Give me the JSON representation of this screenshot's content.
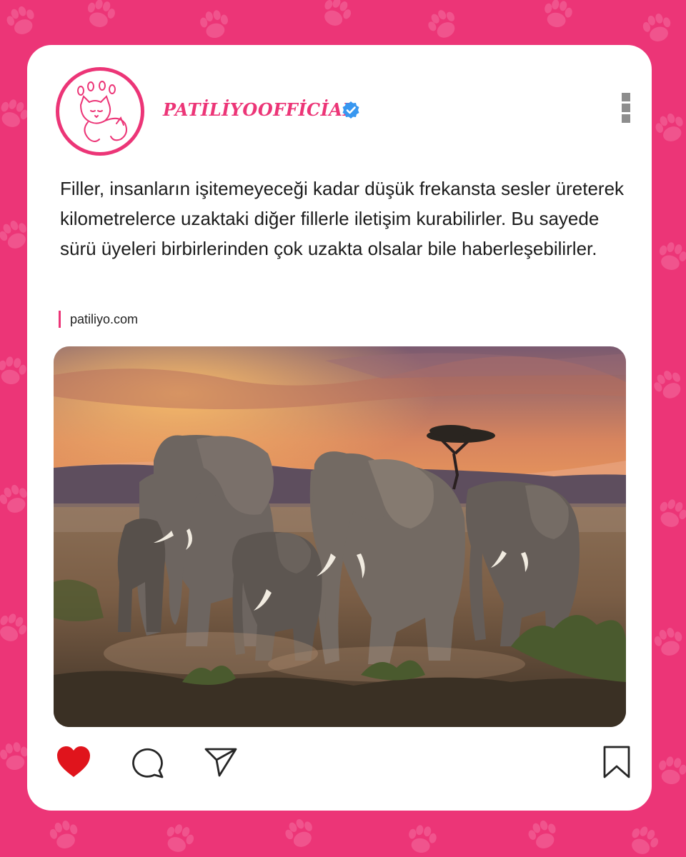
{
  "post": {
    "username": "PATİLİYOOFFİCİAL",
    "caption": "Filler, insanların işitemeyeceği kadar düşük frekansta sesler üreterek kilometrelerce uzaktaki diğer fillerle iletişim kurabilirler. Bu sayede sürü üyeleri birbirlerinden çok uzakta olsalar bile haberleşebilirler.",
    "source": "patiliyo.com",
    "liked": true
  },
  "icons": {
    "avatar": "cat-dog-paw-logo-icon",
    "verified": "verified-badge-icon",
    "more": "more-vertical-icon",
    "like": "heart-icon",
    "comment": "comment-bubble-icon",
    "share": "send-paper-plane-icon",
    "save": "bookmark-icon"
  },
  "colors": {
    "brand_pink": "#ec3577",
    "like_red": "#e0141c",
    "verified_blue": "#3897f0"
  }
}
